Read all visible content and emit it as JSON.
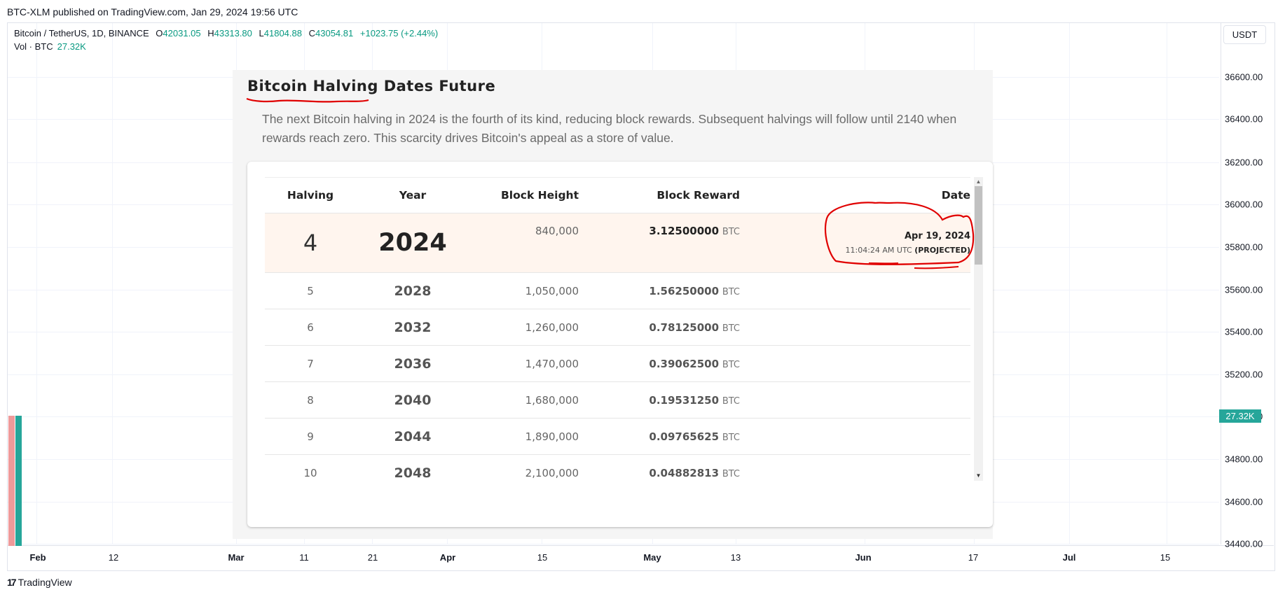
{
  "header": {
    "published": "BTC-XLM published on TradingView.com, Jan 29, 2024 19:56 UTC"
  },
  "legend": {
    "symbol": "Bitcoin / TetherUS, 1D, BINANCE",
    "o_label": "O",
    "o_value": "42031.05",
    "h_label": "H",
    "h_value": "43313.80",
    "l_label": "L",
    "l_value": "41804.88",
    "c_label": "C",
    "c_value": "43054.81",
    "change": "+1023.75 (+2.44%)",
    "vol_label": "Vol · BTC",
    "vol_value": "27.32K"
  },
  "price_axis": {
    "currency": "USDT",
    "ticks": [
      "36600.00",
      "36400.00",
      "36200.00",
      "36000.00",
      "35800.00",
      "35600.00",
      "35400.00",
      "35200.00",
      "35000.00",
      "34800.00",
      "34600.00",
      "34400.00"
    ],
    "volume_badge": "27.32K"
  },
  "time_axis": {
    "labels": [
      {
        "text": "Feb",
        "bold": true
      },
      {
        "text": "12",
        "bold": false
      },
      {
        "text": "Mar",
        "bold": true
      },
      {
        "text": "11",
        "bold": false
      },
      {
        "text": "21",
        "bold": false
      },
      {
        "text": "Apr",
        "bold": true
      },
      {
        "text": "15",
        "bold": false
      },
      {
        "text": "May",
        "bold": true
      },
      {
        "text": "13",
        "bold": false
      },
      {
        "text": "Jun",
        "bold": true
      },
      {
        "text": "17",
        "bold": false
      },
      {
        "text": "Jul",
        "bold": true
      },
      {
        "text": "15",
        "bold": false
      }
    ]
  },
  "footer": {
    "brand": "TradingView",
    "mark": "17"
  },
  "panel": {
    "title": "Bitcoin Halving Dates Future",
    "description": "The next Bitcoin halving in 2024 is the fourth of its kind, reducing block rewards. Subsequent halvings will follow until 2140 when rewards reach zero. This scarcity drives Bitcoin's appeal as a store of value.",
    "columns": [
      "Halving",
      "Year",
      "Block Height",
      "Block Reward",
      "Date"
    ],
    "current": {
      "halving": "4",
      "year": "2024",
      "height": "840,000",
      "reward": "3.12500000",
      "unit": "BTC",
      "date": "Apr 19, 2024",
      "time": "11:04:24 AM UTC",
      "status": "(PROJECTED)"
    },
    "rows": [
      {
        "halving": "5",
        "year": "2028",
        "height": "1,050,000",
        "reward": "1.56250000",
        "unit": "BTC"
      },
      {
        "halving": "6",
        "year": "2032",
        "height": "1,260,000",
        "reward": "0.78125000",
        "unit": "BTC"
      },
      {
        "halving": "7",
        "year": "2036",
        "height": "1,470,000",
        "reward": "0.39062500",
        "unit": "BTC"
      },
      {
        "halving": "8",
        "year": "2040",
        "height": "1,680,000",
        "reward": "0.19531250",
        "unit": "BTC"
      },
      {
        "halving": "9",
        "year": "2044",
        "height": "1,890,000",
        "reward": "0.09765625",
        "unit": "BTC"
      },
      {
        "halving": "10",
        "year": "2048",
        "height": "2,100,000",
        "reward": "0.04882813",
        "unit": "BTC"
      }
    ]
  },
  "colors": {
    "accent_green": "#089981",
    "annotation_red": "#e00000",
    "volume_green": "#26a69a",
    "volume_red": "#ef9a9a"
  }
}
